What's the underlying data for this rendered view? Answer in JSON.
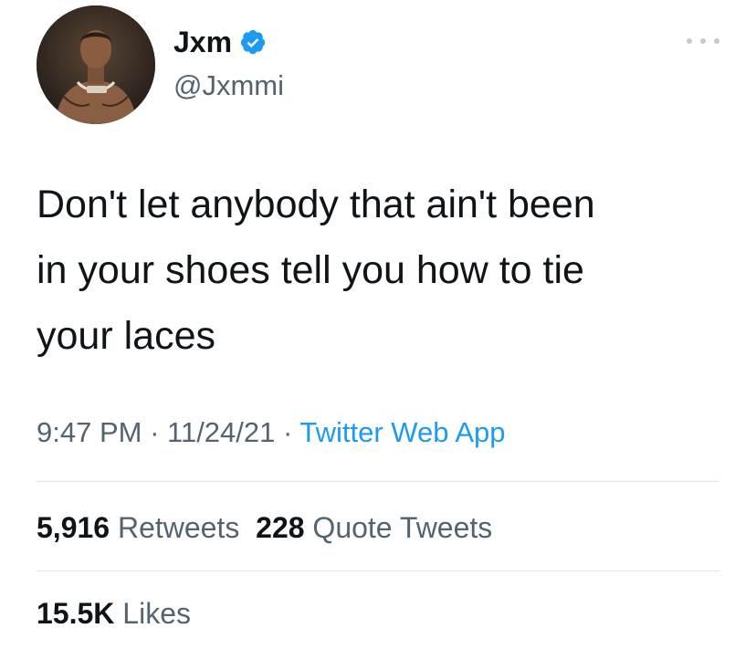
{
  "author": {
    "display_name": "Jxm",
    "handle": "@Jxmmi",
    "verified": true,
    "avatar_icon": "profile-photo",
    "verified_icon": "verified-badge-icon",
    "verified_color": "#1d9bf0"
  },
  "menu_icon": "more-options-icon",
  "tweet": {
    "lines": [
      "Don't let anybody that ain't been",
      "in your shoes tell you how to tie",
      "your laces"
    ]
  },
  "meta": {
    "time": "9:47 PM",
    "separator": " · ",
    "date": "11/24/21",
    "source": "Twitter Web App"
  },
  "stats": {
    "retweets_count": "5,916",
    "retweets_label": "Retweets",
    "quotes_count": "228",
    "quotes_label": "Quote Tweets",
    "likes_count": "15.5K",
    "likes_label": "Likes"
  },
  "colors": {
    "text_primary": "#0f1419",
    "text_secondary": "#536471",
    "link": "#1d9bf0",
    "divider": "#e1e6ea"
  }
}
